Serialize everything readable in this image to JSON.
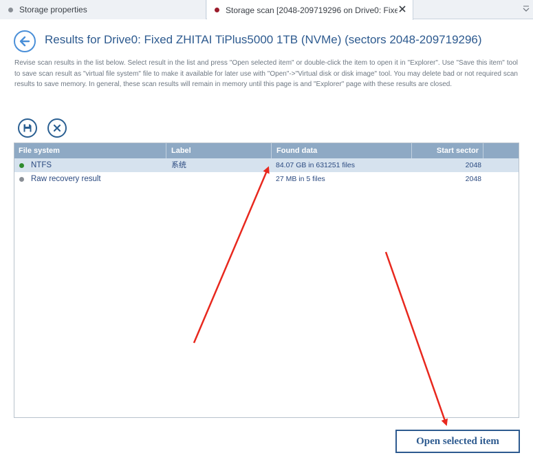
{
  "tabs": [
    {
      "label": "Storage properties",
      "dot_color": "#8a8f96",
      "active": false
    },
    {
      "label": "Storage scan [2048-209719296 on Drive0: Fixed...",
      "dot_color": "#9b1c2c",
      "active": true
    }
  ],
  "header": {
    "title": "Results for Drive0: Fixed ZHITAI TiPlus5000 1TB (NVMe) (sectors 2048-209719296)",
    "description": "Revise scan results in the list below. Select result in the list and press \"Open selected item\" or double-click the item to open it in \"Explorer\". Use \"Save this item\" tool to save scan result as \"virtual file system\" file to make it available for later use with \"Open\"->\"Virtual disk or disk image\" tool. You may delete bad or not required scan results to save memory. In general, these scan results will remain in memory until this page is and \"Explorer\" page with these results are closed."
  },
  "toolbar": {
    "save_icon": "floppy-disk-icon",
    "delete_icon": "close-x-icon"
  },
  "table": {
    "columns": [
      "File system",
      "Label",
      "Found data",
      "Start sector"
    ],
    "rows": [
      {
        "file_system": "NTFS",
        "label": "系统",
        "found_data": "84.07 GB in 631251 files",
        "start_sector": "2048",
        "status_color": "#2e8b2e",
        "selected": true
      },
      {
        "file_system": "Raw recovery result",
        "label": "",
        "found_data": "27 MB in 5 files",
        "start_sector": "2048",
        "status_color": "#8a8f96",
        "selected": false
      }
    ]
  },
  "footer": {
    "open_button": "Open selected item"
  },
  "colors": {
    "accent": "#2d5a8f",
    "header_bg": "#8ea9c4",
    "selected_row": "#d6e2ee",
    "annotation_arrow": "#e8281e"
  }
}
